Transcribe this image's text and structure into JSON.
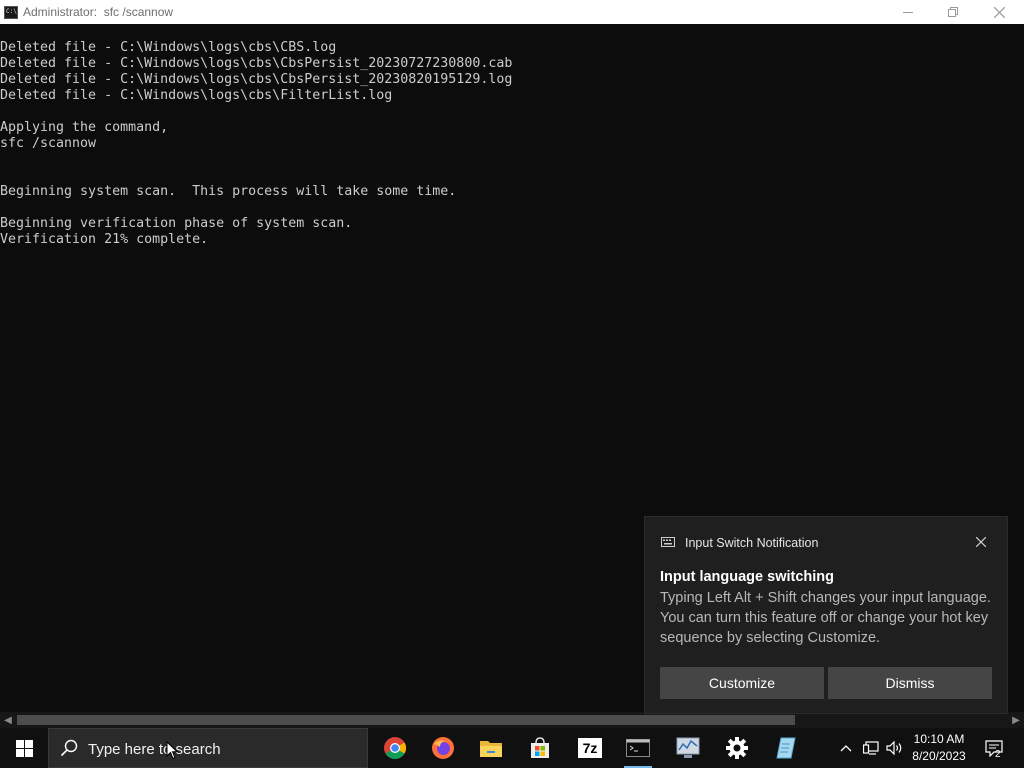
{
  "window": {
    "title": "Administrator:  sfc /scannow",
    "icon_label": "C:\\"
  },
  "console": {
    "lines": [
      "Deleted file - C:\\Windows\\logs\\cbs\\CBS.log",
      "Deleted file - C:\\Windows\\logs\\cbs\\CbsPersist_20230727230800.cab",
      "Deleted file - C:\\Windows\\logs\\cbs\\CbsPersist_20230820195129.log",
      "Deleted file - C:\\Windows\\logs\\cbs\\FilterList.log",
      "",
      "Applying the command,",
      "sfc /scannow",
      "",
      "",
      "Beginning system scan.  This process will take some time.",
      "",
      "Beginning verification phase of system scan.",
      "Verification 21% complete."
    ]
  },
  "notification": {
    "header": "Input Switch Notification",
    "heading": "Input language switching",
    "body": "Typing Left Alt + Shift changes your input language. You can turn this feature off or change your hot key sequence by selecting Customize.",
    "customize_label": "Customize",
    "dismiss_label": "Dismiss"
  },
  "taskbar": {
    "search_placeholder": "Type here to search",
    "pinned": [
      "chrome-icon",
      "firefox-icon",
      "file-explorer-icon",
      "microsoft-store-icon",
      "7zip-icon",
      "command-prompt-icon",
      "system-monitor-icon",
      "settings-icon",
      "notepad-icon"
    ],
    "seven_zip_label": "7z",
    "clock_time": "10:10 AM",
    "clock_date": "8/20/2023",
    "notification_count": "2"
  },
  "colors": {
    "console_bg": "#0c0c0c",
    "console_text": "#cccccc",
    "toast_bg": "#1f1f1f",
    "taskbar_bg": "#101010",
    "accent": "#76b9ed"
  }
}
